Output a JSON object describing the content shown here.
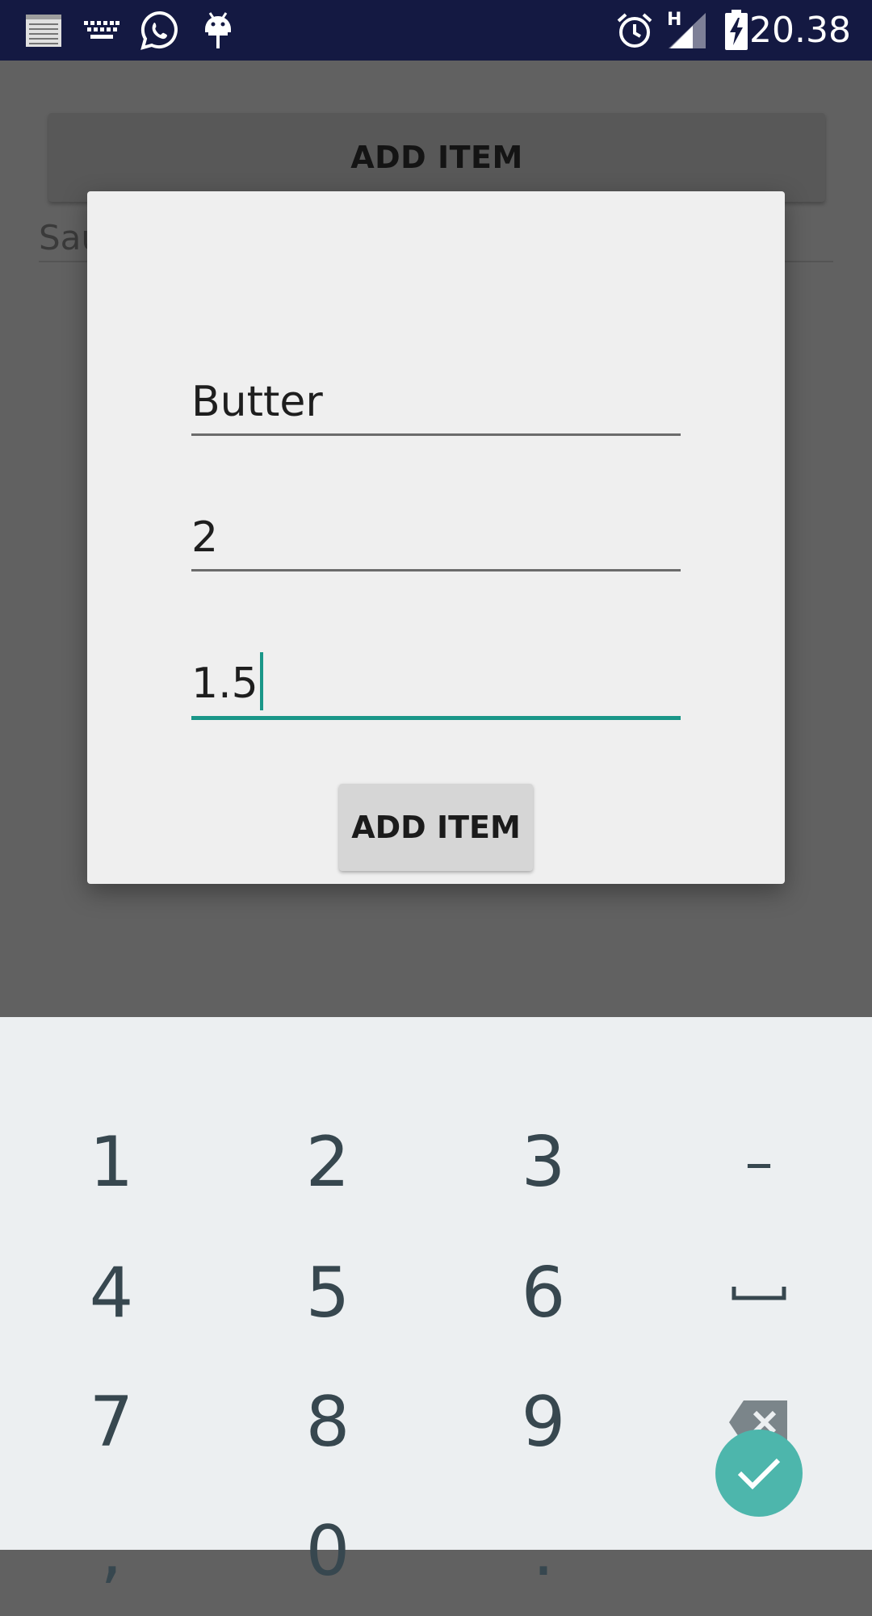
{
  "status_bar": {
    "time": "20.38",
    "network_type": "H",
    "left_icons": [
      "notes-icon",
      "keyboard-icon",
      "whatsapp-icon",
      "android-debug-icon"
    ],
    "right_icons": [
      "alarm-icon",
      "signal-icon",
      "battery-charging-icon"
    ]
  },
  "background": {
    "button_label": "ADD ITEM",
    "field_text": "Sau"
  },
  "dialog": {
    "fields": [
      {
        "value": "Butter"
      },
      {
        "value": "2"
      },
      {
        "value": "1.5"
      }
    ],
    "button_label": "ADD ITEM"
  },
  "keyboard": {
    "keys": [
      "1",
      "2",
      "3",
      "–",
      "4",
      "5",
      "6",
      "␣",
      "7",
      "8",
      "9",
      "backspace",
      ",",
      "0",
      "."
    ],
    "enter_icon": "check-icon",
    "colors": {
      "background": "#eceff1",
      "key_text": "#37474f",
      "enter": "#4db6ac"
    }
  },
  "colors": {
    "status_bar": "#141942",
    "accent": "#1a9688",
    "dialog": "#efefef",
    "scrim": "#616161"
  }
}
